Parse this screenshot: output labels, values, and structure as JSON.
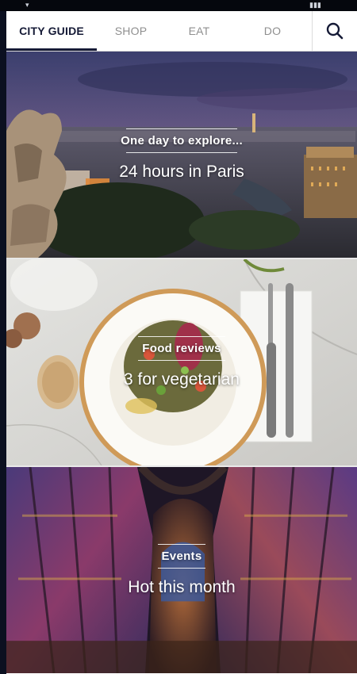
{
  "tabs": [
    {
      "label": "CITY GUIDE",
      "active": true
    },
    {
      "label": "SHOP",
      "active": false
    },
    {
      "label": "EAT",
      "active": false
    },
    {
      "label": "DO",
      "active": false
    }
  ],
  "search": {
    "icon": "search-icon"
  },
  "cards": [
    {
      "kicker": "One day to explore...",
      "title": "24 hours in Paris",
      "image": "paris-skyline-gargoyle"
    },
    {
      "kicker": "Food reviews",
      "title": "3 for vegetarian",
      "image": "vegetarian-salad-plate"
    },
    {
      "kicker": "Events",
      "title": "Hot this month",
      "image": "sainte-chapelle-stained-glass"
    }
  ],
  "colors": {
    "accent": "#151a36",
    "inactive_tab": "#8f8f8f"
  }
}
